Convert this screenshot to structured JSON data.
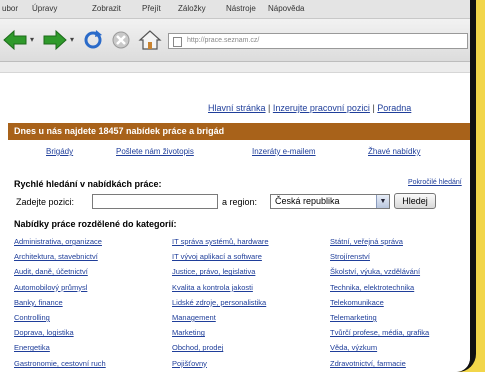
{
  "menu": [
    "ubor",
    "Úpravy",
    "Zobrazit",
    "Přejít",
    "Záložky",
    "Nástroje",
    "Nápověda"
  ],
  "browser": {
    "url": "http://prace.seznam.cz/"
  },
  "header": {
    "links": [
      "Hlavní stránka",
      "Inzerujte pracovní pozici",
      "Poradna"
    ],
    "separator": " | "
  },
  "banner": "Dnes u nás najdete 18457 nabídek práce a brigád",
  "subnav": [
    "Brigády",
    "Pošlete nám životopis",
    "Inzeráty e-mailem",
    "Žhavé nabídky"
  ],
  "search": {
    "title": "Rychlé hledání v nabídkách práce:",
    "advanced_link": "Pokročilé hledání",
    "position_label": "Zadejte pozici:",
    "position_value": "",
    "region_label": "a region:",
    "region_value": "Česká republika",
    "button": "Hledej"
  },
  "categories": {
    "title": "Nabídky práce rozdělené do kategorií:",
    "columns": [
      [
        "Administrativa, organizace",
        "Architektura, stavebnictví",
        "Audit, daně, účetnictví",
        "Automobilový průmysl",
        "Banky, finance",
        "Controlling",
        "Doprava, logistika",
        "Energetika",
        "Gastronomie, cestovní ruch"
      ],
      [
        "IT správa systémů, hardware",
        "IT vývoj aplikací a software",
        "Justice, právo, legislativa",
        "Kvalita a kontrola jakosti",
        "Lidské zdroje, personalistika",
        "Management",
        "Marketing",
        "Obchod, prodej",
        "Pojišťovny"
      ],
      [
        "Státní, veřejná správa",
        "Strojírenství",
        "Školství, výuka, vzdělávání",
        "Technika, elektrotechnika",
        "Telekomunikace",
        "Telemarketing",
        "Tvůrčí profese, média, grafika",
        "Věda, výzkum",
        "Zdravotnictví, farmacie"
      ]
    ]
  }
}
